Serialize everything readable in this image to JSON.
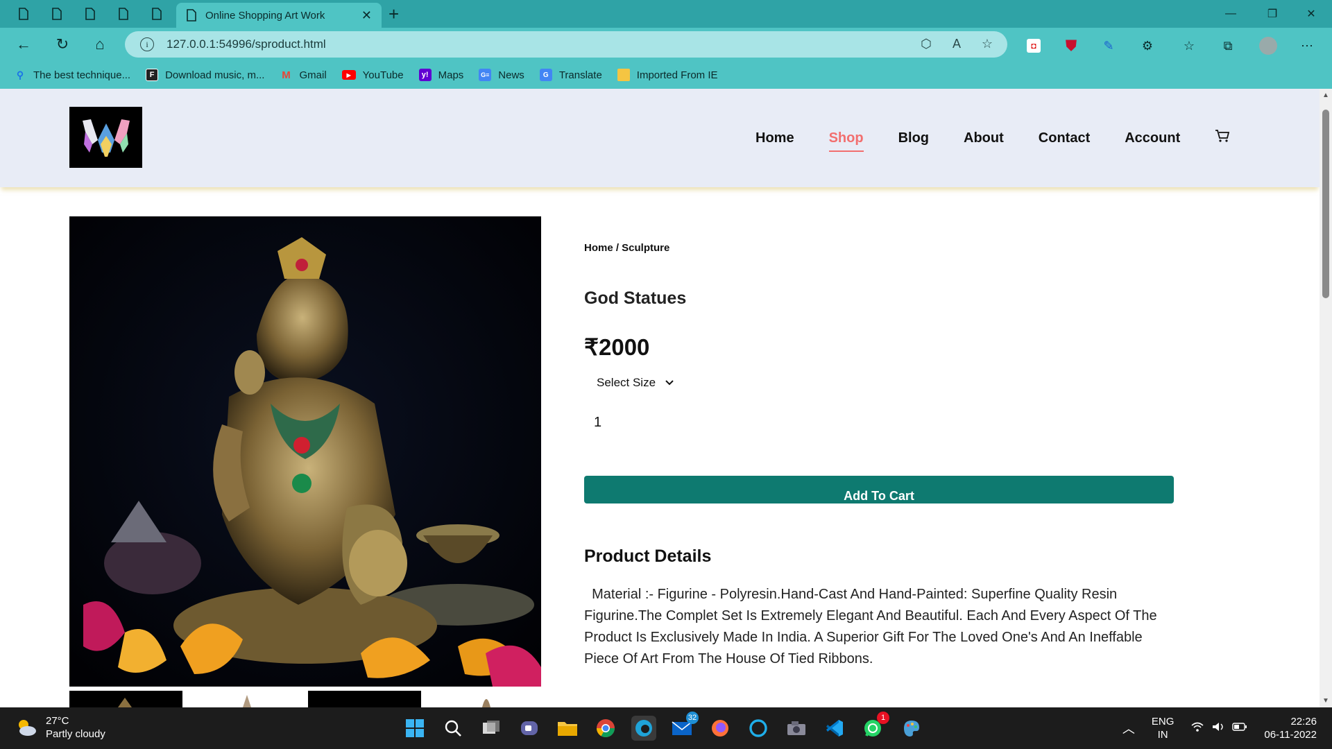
{
  "browser": {
    "tab_title": "Online Shopping Art Work",
    "url": "127.0.0.1:54996/sproduct.html",
    "bookmarks": [
      {
        "label": "The best technique...",
        "icon": "search-icon",
        "color": "#1a73e8"
      },
      {
        "label": "Download music, m...",
        "icon": "f-icon",
        "color": "#222222"
      },
      {
        "label": "Gmail",
        "icon": "gmail-icon",
        "color": "#ea4335"
      },
      {
        "label": "YouTube",
        "icon": "youtube-icon",
        "color": "#ff0000"
      },
      {
        "label": "Maps",
        "icon": "yahoo-icon",
        "color": "#6001d2"
      },
      {
        "label": "News",
        "icon": "news-icon",
        "color": "#4285f4"
      },
      {
        "label": "Translate",
        "icon": "translate-icon",
        "color": "#4285f4"
      },
      {
        "label": "Imported From IE",
        "icon": "folder-icon",
        "color": "#f5c542"
      }
    ]
  },
  "site": {
    "nav": [
      {
        "label": "Home",
        "active": false
      },
      {
        "label": "Shop",
        "active": true
      },
      {
        "label": "Blog",
        "active": false
      },
      {
        "label": "About",
        "active": false
      },
      {
        "label": "Contact",
        "active": false
      },
      {
        "label": "Account",
        "active": false
      }
    ],
    "accent": "#f26f6f"
  },
  "product": {
    "breadcrumb": "Home / Sculpture",
    "title": "God Statues",
    "price": "₹2000",
    "size_select": "Select Size",
    "quantity": "1",
    "add_to_cart": "Add To Cart",
    "details_title": "Product Details",
    "details_text": "  Material :- Figurine - Polyresin.Hand-Cast And Hand-Painted: Superfine Quality Resin Figurine.The Complet Set Is Extremely Elegant And Beautiful. Each And Every Aspect Of The Product Is Exclusively Made In India. A Superior Gift For The Loved One's And An Ineffable Piece Of Art From The House Of Tied Ribbons.",
    "button_color": "#0e7a70"
  },
  "taskbar": {
    "temperature": "27°C",
    "weather": "Partly cloudy",
    "mail_badge": "32",
    "whatsapp_badge": "1",
    "lang_top": "ENG",
    "lang_bottom": "IN",
    "time": "22:26",
    "date": "06-11-2022"
  }
}
